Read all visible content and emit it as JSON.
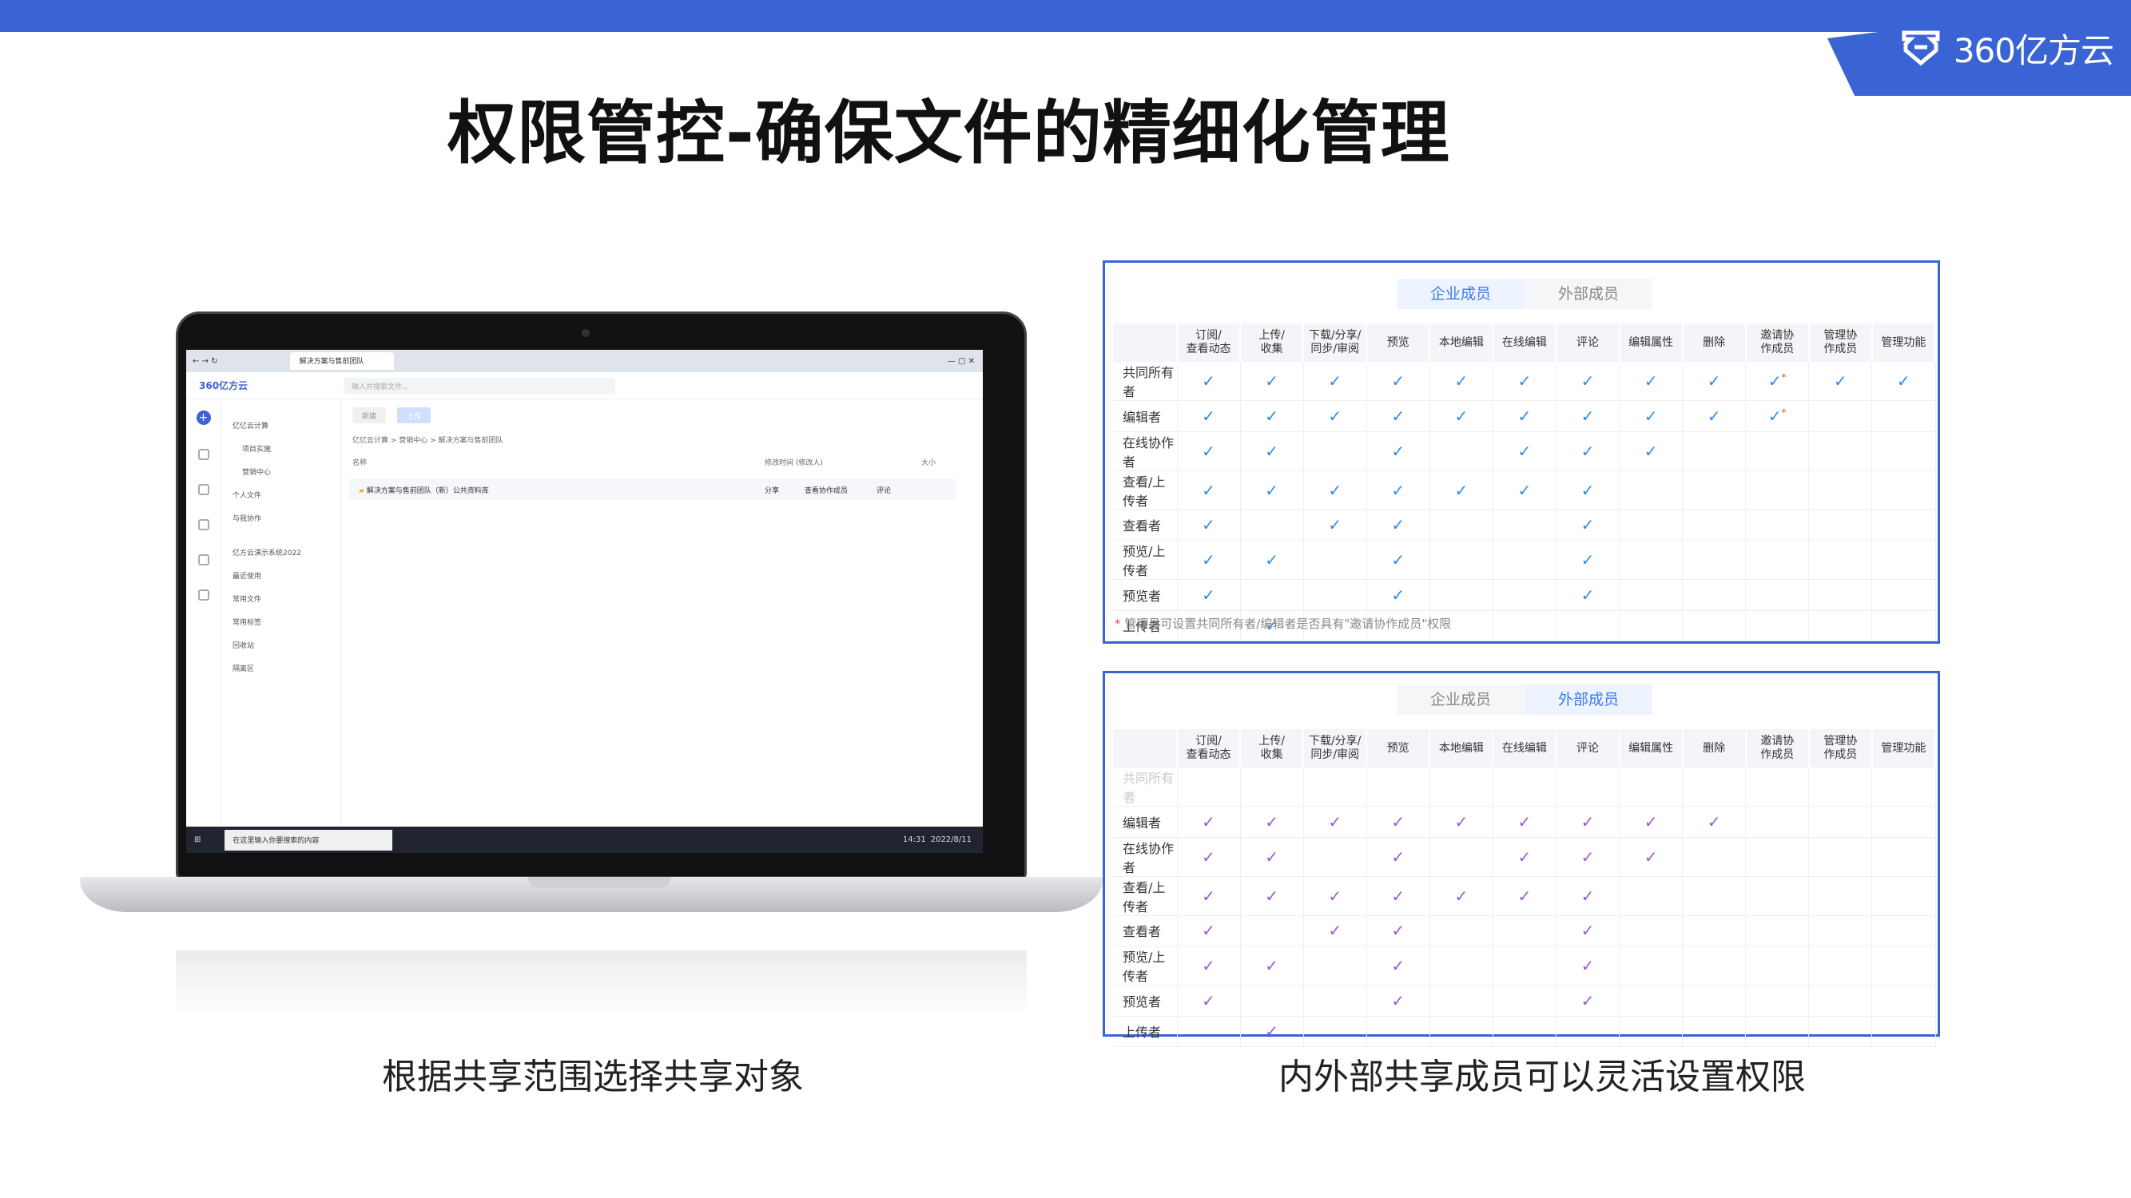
{
  "slide": {
    "title": "权限管控-确保文件的精细化管理",
    "brand": "360亿方云",
    "caption_left": "根据共享范围选择共享对象",
    "caption_right": "内外部共享成员可以灵活设置权限"
  },
  "laptop": {
    "tab_title": "解决方案与售前团队",
    "app_logo": "360亿方云",
    "search_placeholder": "输入并搜索文件...",
    "btn_new": "新建",
    "btn_upload": "上传",
    "breadcrumb": "亿亿云计算 > 营销中心 > 解决方案与售前团队",
    "col_name": "名称",
    "col_modified": "修改时间 (修改人)",
    "col_size": "大小",
    "row_file": "解决方案与售前团队（新）公共资料库",
    "row_share": "分享",
    "row_collab": "查看协作成员",
    "row_comment": "评论",
    "sidebar": [
      "亿亿云计算",
      "项目实施",
      "营销中心",
      "个人文件",
      "与我协作",
      "亿方云演示系统2022",
      "最近使用",
      "常用文件",
      "常用标签",
      "回收站",
      "隔离区"
    ],
    "taskbar_search": "在这里输入你要搜索的内容",
    "clock": "14:31",
    "date": "2022/8/11"
  },
  "tables": {
    "headers": [
      "订阅/\n查看动态",
      "上传/\n收集",
      "下载/分享/\n同步/审阅",
      "预览",
      "本地编辑",
      "在线编辑",
      "评论",
      "编辑属性",
      "删除",
      "邀请协\n作成员",
      "管理协\n作成员",
      "管理功能"
    ],
    "roles": [
      "共同所有者",
      "编辑者",
      "在线协作者",
      "查看/上传者",
      "查看者",
      "预览/上传者",
      "预览者",
      "上传者"
    ],
    "tab_internal": "企业成员",
    "tab_external": "外部成员",
    "check": "✓",
    "internal": {
      "matrix": [
        [
          1,
          1,
          1,
          1,
          1,
          1,
          1,
          1,
          1,
          2,
          1,
          1
        ],
        [
          1,
          1,
          1,
          1,
          1,
          1,
          1,
          1,
          1,
          2,
          0,
          0
        ],
        [
          1,
          1,
          0,
          1,
          0,
          1,
          1,
          1,
          0,
          0,
          0,
          0
        ],
        [
          1,
          1,
          1,
          1,
          1,
          1,
          1,
          0,
          0,
          0,
          0,
          0
        ],
        [
          1,
          0,
          1,
          1,
          0,
          0,
          1,
          0,
          0,
          0,
          0,
          0
        ],
        [
          1,
          1,
          0,
          1,
          0,
          0,
          1,
          0,
          0,
          0,
          0,
          0
        ],
        [
          1,
          0,
          0,
          1,
          0,
          0,
          1,
          0,
          0,
          0,
          0,
          0
        ],
        [
          0,
          1,
          0,
          0,
          0,
          0,
          0,
          0,
          0,
          0,
          0,
          0
        ]
      ],
      "note_mark": "*",
      "note": "管理员可设置共同所有者/编辑者是否具有\"邀请协作成员\"权限"
    },
    "external": {
      "matrix": [
        [
          0,
          0,
          0,
          0,
          0,
          0,
          0,
          0,
          0,
          0,
          0,
          0
        ],
        [
          1,
          1,
          1,
          1,
          1,
          1,
          1,
          1,
          1,
          0,
          0,
          0
        ],
        [
          1,
          1,
          0,
          1,
          0,
          1,
          1,
          1,
          0,
          0,
          0,
          0
        ],
        [
          1,
          1,
          1,
          1,
          1,
          1,
          1,
          0,
          0,
          0,
          0,
          0
        ],
        [
          1,
          0,
          1,
          1,
          0,
          0,
          1,
          0,
          0,
          0,
          0,
          0
        ],
        [
          1,
          1,
          0,
          1,
          0,
          0,
          1,
          0,
          0,
          0,
          0,
          0
        ],
        [
          1,
          0,
          0,
          1,
          0,
          0,
          1,
          0,
          0,
          0,
          0,
          0
        ],
        [
          0,
          1,
          0,
          0,
          0,
          0,
          0,
          0,
          0,
          0,
          0,
          0
        ]
      ],
      "disabled_rows": [
        0
      ]
    },
    "colors": {
      "internal_check": "#2d8cf0",
      "external_check": "#9b59d8",
      "accent": "#3a63d4"
    }
  }
}
